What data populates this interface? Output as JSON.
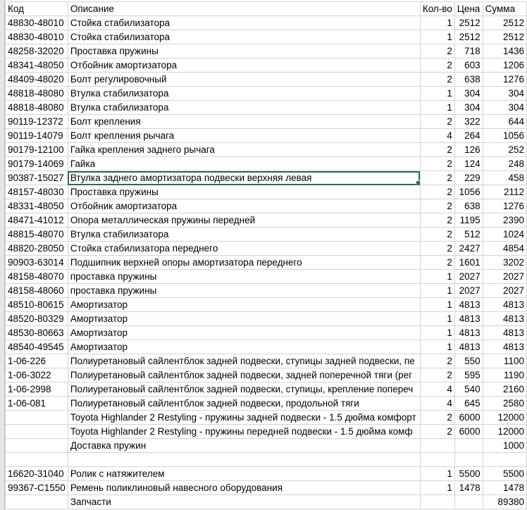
{
  "headers": [
    "Код",
    "Описание",
    "Кол-во",
    "Цена",
    "Сумма"
  ],
  "selected_row": 11,
  "rows": [
    [
      "48830-48010",
      "Стойка стабилизатора",
      "1",
      "2512",
      "2512"
    ],
    [
      "48830-48010",
      "Стойка стабилизатора",
      "1",
      "2512",
      "2512"
    ],
    [
      "48258-32020",
      "Проставка пружины",
      "2",
      "718",
      "1436"
    ],
    [
      "48341-48050",
      "Отбойник амортизатора",
      "2",
      "603",
      "1206"
    ],
    [
      "48409-48020",
      "Болт регулировочный",
      "2",
      "638",
      "1276"
    ],
    [
      "48818-48080",
      "Втулка стабилизатора",
      "1",
      "304",
      "304"
    ],
    [
      "48818-48080",
      "Втулка стабилизатора",
      "1",
      "304",
      "304"
    ],
    [
      "90119-12372",
      "Болт крепления",
      "2",
      "322",
      "644"
    ],
    [
      "90119-14079",
      "Болт крепления рычага",
      "4",
      "264",
      "1056"
    ],
    [
      "90179-12100",
      "Гайка крепления заднего рычага",
      "2",
      "126",
      "252"
    ],
    [
      "90179-14069",
      "Гайка",
      "2",
      "124",
      "248"
    ],
    [
      "90387-15027",
      "Втулка заднего амортизатора подвески верхняя левая",
      "2",
      "229",
      "458"
    ],
    [
      "48157-48030",
      "Проставка пружины",
      "2",
      "1056",
      "2112"
    ],
    [
      "48331-48050",
      "Отбойник амортизатора",
      "2",
      "638",
      "1276"
    ],
    [
      "48471-41012",
      "Опора металлическая пружины передней",
      "2",
      "1195",
      "2390"
    ],
    [
      "48815-48070",
      "Втулка стабилизатора",
      "2",
      "512",
      "1024"
    ],
    [
      "48820-28050",
      "Стойка стабилизатора переднего",
      "2",
      "2427",
      "4854"
    ],
    [
      "90903-63014",
      "Подшипник верхней опоры амортизатора переднего",
      "2",
      "1601",
      "3202"
    ],
    [
      "48158-48070",
      "проставка пружины",
      "1",
      "2027",
      "2027"
    ],
    [
      "48158-48060",
      "проставка пружины",
      "1",
      "2027",
      "2027"
    ],
    [
      "48510-80615",
      "Амортизатор",
      "1",
      "4813",
      "4813"
    ],
    [
      "48520-80329",
      "Амортизатор",
      "1",
      "4813",
      "4813"
    ],
    [
      "48530-80663",
      "Амортизатор",
      "1",
      "4813",
      "4813"
    ],
    [
      "48540-49545",
      "Амортизатор",
      "1",
      "4813",
      "4813"
    ],
    [
      "1-06-226",
      "Полиуретановый сайлентблок задней подвески, ступицы задней подвески, пе",
      "2",
      "550",
      "1100"
    ],
    [
      "1-06-3022",
      "Полиуретановый сайлентблок задней подвески, задней поперечной тяги (рег",
      "2",
      "595",
      "1190"
    ],
    [
      "1-06-2998",
      "Полиуретановый сайлентблок задней подвески, ступицы, крепление попереч",
      "4",
      "540",
      "2160"
    ],
    [
      "1-06-081",
      "Полиуретановый сайлентблок задней подвески, продольной тяги",
      "4",
      "645",
      "2580"
    ],
    [
      "",
      "Toyota Highlander 2 Restyling - пружины задней подвески - 1.5 дюйма комфорт",
      "2",
      "6000",
      "12000"
    ],
    [
      "",
      "Toyota Highlander 2 Restyling - пружины передней подвески - 1.5 дюйма комф",
      "2",
      "6000",
      "12000"
    ],
    [
      "",
      "Доставка пружин",
      "",
      "",
      "1000"
    ],
    [
      "",
      "",
      "",
      "",
      ""
    ],
    [
      "16620-31040",
      "Ролик с натяжителем",
      "1",
      "5500",
      "5500"
    ],
    [
      "99367-C1550",
      "Ремень поликлиновый навесного оборудования",
      "1",
      "1478",
      "1478"
    ],
    [
      "",
      "Запчасти",
      "",
      "",
      "89380"
    ]
  ]
}
